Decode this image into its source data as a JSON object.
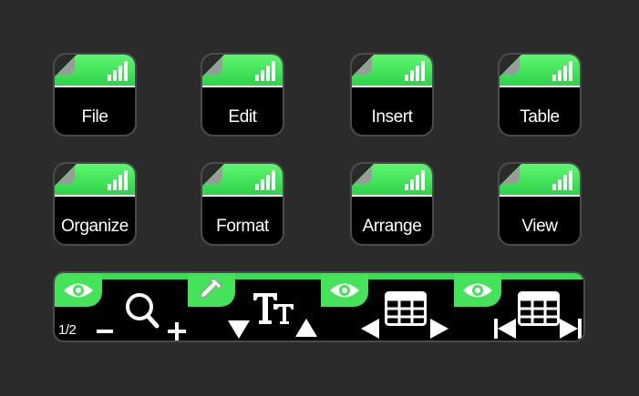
{
  "keys": [
    {
      "label": "File"
    },
    {
      "label": "Edit"
    },
    {
      "label": "Insert"
    },
    {
      "label": "Table"
    },
    {
      "label": "Organize"
    },
    {
      "label": "Format"
    },
    {
      "label": "Arrange"
    },
    {
      "label": "View"
    }
  ],
  "control_bar": {
    "page_indicator": "1/2",
    "segments": [
      {
        "tab_icon": "eye-icon",
        "control": "zoom",
        "controls": [
          "minus-icon",
          "magnifier-icon",
          "plus-icon"
        ]
      },
      {
        "tab_icon": "eyedropper-icon",
        "control": "font-size",
        "controls": [
          "triangle-down-icon",
          "text-size-icon",
          "triangle-up-icon"
        ]
      },
      {
        "tab_icon": "eye-icon",
        "control": "table-column",
        "controls": [
          "triangle-left-icon",
          "table-icon",
          "triangle-right-icon"
        ]
      },
      {
        "tab_icon": "eye-icon",
        "control": "table-column-end",
        "controls": [
          "skip-start-icon",
          "table-icon",
          "skip-end-icon"
        ]
      }
    ]
  },
  "colors": {
    "background": "#2b2b2b",
    "accent_green": "#44e35a",
    "key_body": "#000000",
    "text": "#ffffff"
  }
}
